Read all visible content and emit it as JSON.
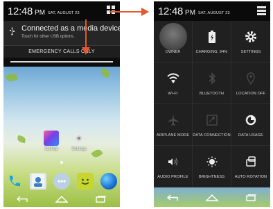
{
  "left_phone": {
    "status": {
      "time": "12:48",
      "ampm": "PM",
      "date": "SAT, AUGUST 23"
    },
    "notification": {
      "icon": "usb-icon",
      "title": "Connected as a media device",
      "subtitle": "Touch for other USB options."
    },
    "emergency": "EMERGENCY CALLS ONLY",
    "apps": [
      {
        "label": "Gallery",
        "icon": "gallery-icon"
      },
      {
        "label": "Settings",
        "icon": "settings-gear-icon"
      }
    ],
    "dock": [
      "phone-icon",
      "contacts-icon",
      "apps-drawer-icon",
      "messaging-icon",
      "browser-icon"
    ],
    "nav": [
      "back-icon",
      "home-icon",
      "recents-icon"
    ]
  },
  "right_phone": {
    "status": {
      "time": "12:48",
      "ampm": "PM",
      "date": "SAT, AUGUST 23"
    },
    "tiles": [
      {
        "label": "OWNER",
        "icon": "owner-avatar"
      },
      {
        "label": "CHARGING, 94%",
        "icon": "battery-icon"
      },
      {
        "label": "SETTINGS",
        "icon": "gear-icon"
      },
      {
        "label": "WI-FI",
        "icon": "wifi-icon"
      },
      {
        "label": "BLUETOOTH",
        "icon": "bluetooth-icon"
      },
      {
        "label": "LOCATION OFF",
        "icon": "location-icon"
      },
      {
        "label": "AIRPLANE MODE",
        "icon": "airplane-icon"
      },
      {
        "label": "DATA CONNECTION",
        "icon": "data-connection-icon"
      },
      {
        "label": "DATA USAGE",
        "icon": "data-usage-icon"
      },
      {
        "label": "AUDIO PROFILE",
        "icon": "audio-profile-icon"
      },
      {
        "label": "BRIGHTNESS",
        "icon": "brightness-icon"
      },
      {
        "label": "AUTO ROTATION",
        "icon": "auto-rotate-icon"
      }
    ],
    "nav": [
      "back-icon",
      "home-icon",
      "recents-icon"
    ]
  },
  "colors": {
    "arrow": "#e8572b",
    "panel_bg": "#202020",
    "text": "#f2f2f2"
  }
}
